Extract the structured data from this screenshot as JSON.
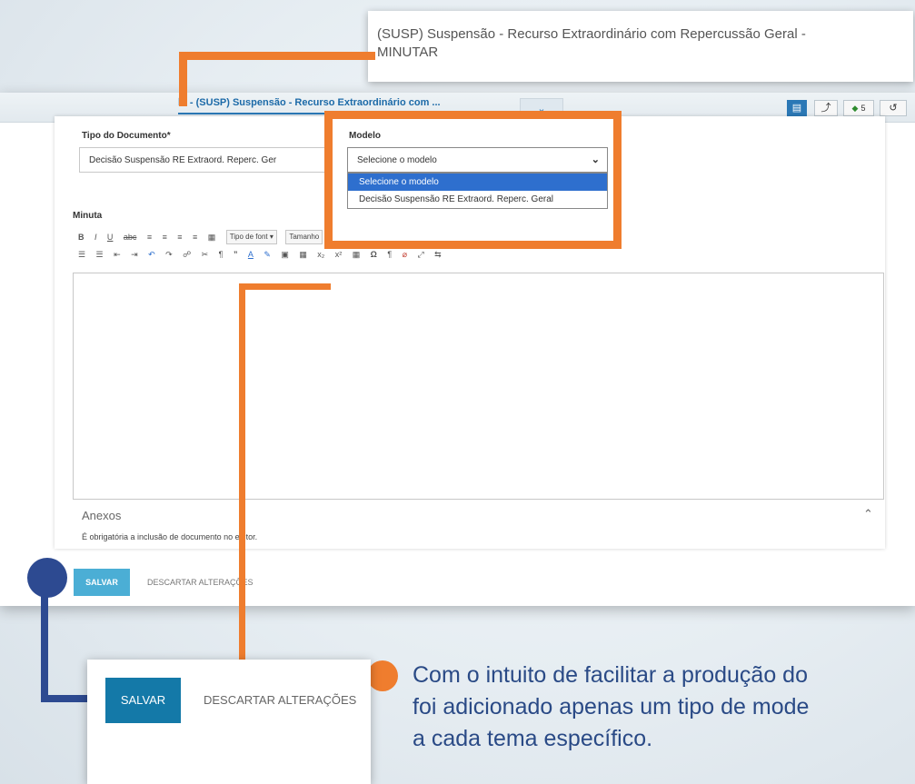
{
  "tooltip": {
    "line1": "(SUSP) Suspensão - Recurso Extraordinário com Repercussão Geral -",
    "line2": "MINUTAR"
  },
  "window": {
    "tab_title": "☐ - (SUSP) Suspensão - Recurso Extraordinário com ...",
    "expand_icon": "chevron-down-icon",
    "toolbar": {
      "tag_count": "5"
    }
  },
  "form": {
    "tipo_documento_label": "Tipo do Documento*",
    "tipo_documento_value": "Decisão Suspensão RE Extraord. Reperc. Ger",
    "modelo_label": "Modelo",
    "modelo_selected": "Selecione o modelo",
    "modelo_options": [
      "Selecione o modelo",
      "Decisão Suspensão RE Extraord. Reperc. Geral"
    ],
    "minuta_label": "Minuta",
    "editor": {
      "font_combo": "Tipo de font",
      "size_combo": "Tamanho"
    },
    "anexos_title": "Anexos",
    "anexos_note": "É obrigatória a inclusão de documento no editor.",
    "save_label": "SALVAR",
    "discard_label": "DESCARTAR ALTERAÇÕES"
  },
  "zoom": {
    "save_label": "SALVAR",
    "discard_label": "DESCARTAR ALTERAÇÕES"
  },
  "caption": {
    "line1": "Com o intuito de facilitar a produção do",
    "line2": "foi adicionado apenas um tipo de mode",
    "line3": "a cada tema específico."
  },
  "colors": {
    "highlight_orange": "#ef7d2e",
    "callout_blue": "#2d4a91",
    "primary_button": "#4baed5",
    "caption_text": "#2a4a86"
  }
}
